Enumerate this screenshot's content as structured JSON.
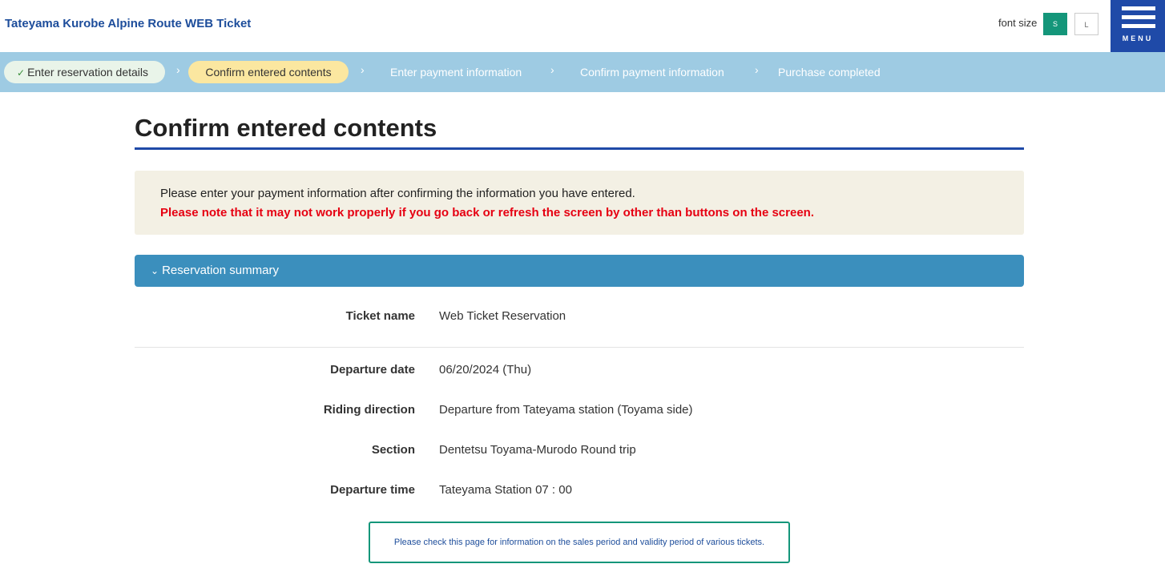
{
  "header": {
    "site_title": "Tateyama Kurobe Alpine Route WEB Ticket",
    "font_size_label": "font size",
    "font_small": "S",
    "font_large": "L",
    "menu_label": "MENU",
    "accent_color": "#1f4aa8"
  },
  "steps": [
    {
      "label": "Enter reservation details",
      "state": "done"
    },
    {
      "label": "Confirm entered contents",
      "state": "current"
    },
    {
      "label": "Enter payment information",
      "state": "future"
    },
    {
      "label": "Confirm payment information",
      "state": "future"
    },
    {
      "label": "Purchase completed",
      "state": "future"
    }
  ],
  "main": {
    "page_title": "Confirm entered contents",
    "notice": {
      "line1": "Please enter your payment information after confirming the information you have entered.",
      "line2": "Please note that it may not work properly if you go back or refresh the screen by other than buttons on the screen."
    },
    "summary_title": "Reservation summary",
    "details": [
      {
        "label": "Ticket name",
        "value": "Web Ticket Reservation"
      },
      {
        "label": "Departure date",
        "value": "06/20/2024 (Thu)"
      },
      {
        "label": "Riding direction",
        "value": "Departure from Tateyama station (Toyama side)"
      },
      {
        "label": "Section",
        "value": "Dentetsu Toyama-Murodo Round trip"
      },
      {
        "label": "Departure time",
        "value": "Tateyama Station 07 : 00"
      }
    ],
    "info_link": "Please check this page for information on the sales period and validity period of various tickets."
  }
}
